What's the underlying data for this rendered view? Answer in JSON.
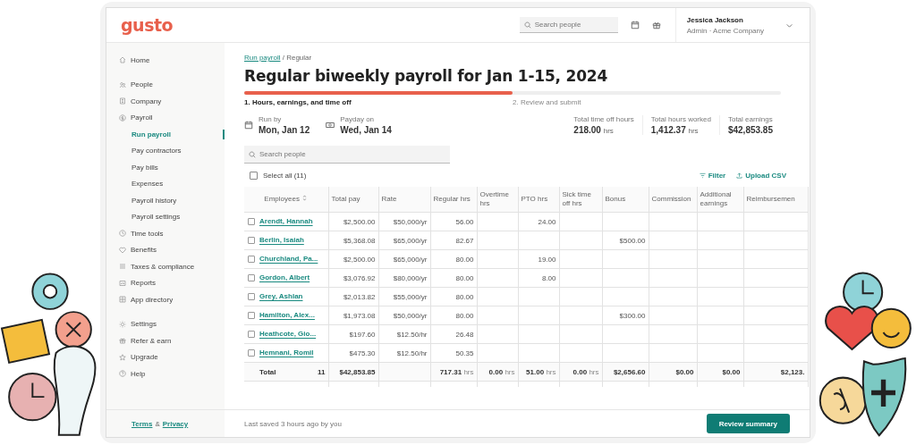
{
  "header": {
    "logo": "gusto",
    "search": {
      "placeholder": "Search people"
    },
    "user": {
      "name": "Jessica Jackson",
      "role": "Admin · Acme Company"
    }
  },
  "sidebar": {
    "sections": [
      {
        "items": [
          {
            "label": "Home",
            "selected": false
          }
        ]
      },
      {
        "items": [
          {
            "label": "People",
            "selected": false
          },
          {
            "label": "Company",
            "selected": false
          },
          {
            "label": "Payroll",
            "selected": false,
            "children": [
              {
                "label": "Run payroll",
                "selected": true
              },
              {
                "label": "Pay contractors",
                "selected": false
              },
              {
                "label": "Pay bills",
                "selected": false
              },
              {
                "label": "Expenses",
                "selected": false
              },
              {
                "label": "Payroll history",
                "selected": false
              },
              {
                "label": "Payroll settings",
                "selected": false
              }
            ]
          },
          {
            "label": "Time tools",
            "selected": false
          },
          {
            "label": "Benefits",
            "selected": false
          },
          {
            "label": "Taxes & compliance",
            "selected": false
          },
          {
            "label": "Reports",
            "selected": false
          },
          {
            "label": "App directory",
            "selected": false
          }
        ]
      },
      {
        "items": [
          {
            "label": "Settings",
            "selected": false
          },
          {
            "label": "Refer & earn",
            "selected": false
          },
          {
            "label": "Upgrade",
            "selected": false
          },
          {
            "label": "Help",
            "selected": false
          }
        ]
      }
    ],
    "footer": {
      "terms": "Terms",
      "amp": "&",
      "privacy": "Privacy"
    }
  },
  "breadcrumb": {
    "link": "Run payroll",
    "current": "/ Regular"
  },
  "title": "Regular biweekly payroll for Jan 1-15, 2024",
  "progress": {
    "level": 0.5,
    "steps": [
      "1. Hours, earnings, and time off",
      "2. Review and submit"
    ]
  },
  "dates": [
    {
      "label": "Run by",
      "value": "Mon, Jan 12"
    },
    {
      "label": "Payday on",
      "value": "Wed, Jan 14"
    }
  ],
  "stats": [
    {
      "label": "Total time off hours",
      "value": "218.00",
      "unit": "hrs"
    },
    {
      "label": "Total hours worked",
      "value": "1,412.37",
      "unit": "hrs"
    },
    {
      "label": "Total earnings",
      "value": "$42,853.85"
    }
  ],
  "search": {
    "placeholder": "Search people"
  },
  "select_all": {
    "label": "Select all (11)",
    "checked": false
  },
  "actions": [
    "Filter",
    "Upload CSV"
  ],
  "table": {
    "columns": [
      "Employees",
      "Total pay",
      "Rate",
      "Regular hrs",
      "Overtime hrs",
      "PTO hrs",
      "Sick time off hrs",
      "Bonus",
      "Commission",
      "Additional earnings",
      "Reimbursemen"
    ],
    "rows": [
      {
        "checked": false,
        "cells": [
          "Arendt, Hannah",
          "$2,500.00",
          "$50,000/yr",
          "56.00",
          null,
          "24.00",
          null,
          null,
          null,
          null,
          null
        ]
      },
      {
        "checked": false,
        "cells": [
          "Berlin, Isaiah",
          "$5,368.08",
          "$65,000/yr",
          "82.67",
          null,
          null,
          null,
          "$500.00",
          null,
          null,
          null
        ]
      },
      {
        "checked": false,
        "cells": [
          "Churchland, Pa...",
          "$2,500.00",
          "$65,000/yr",
          "80.00",
          null,
          "19.00",
          null,
          null,
          null,
          null,
          null
        ]
      },
      {
        "checked": false,
        "cells": [
          "Gordon, Albert",
          "$3,076.92",
          "$80,000/yr",
          "80.00",
          null,
          "8.00",
          null,
          null,
          null,
          null,
          null
        ]
      },
      {
        "checked": false,
        "cells": [
          "Grey, Ashlan",
          "$2,013.82",
          "$55,000/yr",
          "80.00",
          null,
          null,
          null,
          null,
          null,
          null,
          null
        ]
      },
      {
        "checked": false,
        "cells": [
          "Hamilton, Alex...",
          "$1,973.08",
          "$50,000/yr",
          "80.00",
          null,
          null,
          null,
          "$300.00",
          null,
          null,
          null
        ]
      },
      {
        "checked": false,
        "cells": [
          "Heathcote, Gio...",
          "$197.60",
          "$12.50/hr",
          "26.48",
          null,
          null,
          null,
          null,
          null,
          null,
          null
        ]
      },
      {
        "checked": false,
        "cells": [
          "Hemnani, Romil",
          "$475.30",
          "$12.50/hr",
          "50.35",
          null,
          null,
          null,
          null,
          null,
          null,
          null
        ]
      }
    ],
    "total": {
      "label": "Total",
      "count": "11",
      "cells": [
        {
          "value": "$42,853.85"
        },
        null,
        {
          "value": "717.31",
          "unit": "hrs"
        },
        {
          "value": "0.00",
          "unit": "hrs"
        },
        {
          "value": "51.00",
          "unit": "hrs"
        },
        {
          "value": "0.00",
          "unit": "hrs"
        },
        {
          "value": "$2,656.60"
        },
        {
          "value": "$0.00"
        },
        {
          "value": "$0.00"
        },
        {
          "value": "$2,123."
        }
      ]
    }
  },
  "status": "Last saved 3 hours ago by you",
  "primary_button": "Review summary"
}
